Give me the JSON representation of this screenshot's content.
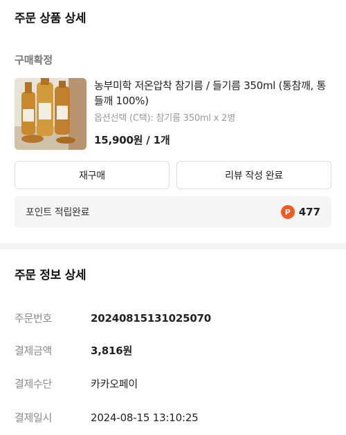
{
  "header": {
    "title": "주문 상품 상세"
  },
  "order_status": "구매확정",
  "product": {
    "name": "농부미학 저온압착 참기름 / 들기름 350ml (통참깨, 통들깨 100%)",
    "option": "옵션선택 (C택): 참기름 350ml x 2병",
    "price": "15,900원 / 1개",
    "image_icon": "sesame-oil-bottles-photo"
  },
  "actions": {
    "rebuy_label": "재구매",
    "review_label": "리뷰 작성 완료"
  },
  "points": {
    "label": "포인트 적립완료",
    "icon_letter": "P",
    "value": "477",
    "icon_color": "#f05a23"
  },
  "order_detail": {
    "title": "주문 정보 상세",
    "rows": [
      {
        "label": "주문번호",
        "value": "20240815131025070"
      },
      {
        "label": "결제금액",
        "value": "3,816원"
      },
      {
        "label": "결제수단",
        "value": "카카오페이"
      },
      {
        "label": "결제일시",
        "value": "2024-08-15 13:10:25"
      }
    ]
  }
}
